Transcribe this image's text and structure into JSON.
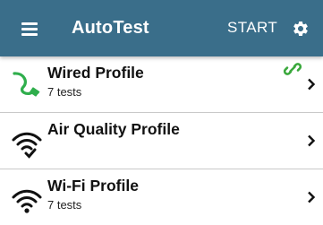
{
  "app_bar": {
    "title": "AutoTest",
    "start_label": "START",
    "color": "#3a6e8a"
  },
  "profiles": [
    {
      "title": "Wired Profile",
      "subtitle": "7 tests",
      "icon": "ethernet-cable-icon",
      "icon_color": "#2fae4c",
      "linked": true,
      "link_color": "#3aa83c"
    },
    {
      "title": "Air Quality Profile",
      "subtitle": "",
      "icon": "wifi-check-icon",
      "icon_color": "#111111",
      "linked": false
    },
    {
      "title": "Wi-Fi Profile",
      "subtitle": "7 tests",
      "icon": "wifi-icon",
      "icon_color": "#111111",
      "linked": false
    }
  ]
}
